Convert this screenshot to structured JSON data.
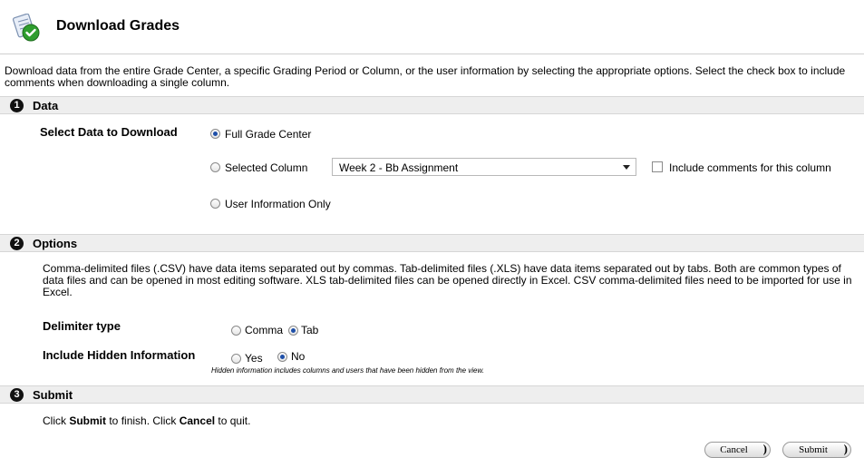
{
  "header": {
    "title": "Download Grades",
    "icon": "download-grades-icon"
  },
  "intro": "Download data from the entire Grade Center, a specific Grading Period or Column, or the user information by selecting the appropriate options. Select the check box to include comments when downloading a single column.",
  "steps": [
    {
      "number": "1",
      "title": "Data"
    },
    {
      "number": "2",
      "title": "Options"
    },
    {
      "number": "3",
      "title": "Submit"
    }
  ],
  "data_section": {
    "label": "Select Data to Download",
    "options": [
      {
        "label": "Full Grade Center",
        "checked": true
      },
      {
        "label": "Selected Column",
        "checked": false
      },
      {
        "label": "User Information Only",
        "checked": false
      }
    ],
    "column_select": {
      "value": "Week 2 - Bb Assignment"
    },
    "include_comments": {
      "label": "Include comments for this column",
      "checked": false
    }
  },
  "options_section": {
    "description": "Comma-delimited files (.CSV) have data items separated out by commas. Tab-delimited files (.XLS) have data items separated out by tabs. Both are common types of data files and can be opened in most editing software. XLS tab-delimited files can be opened directly in Excel. CSV comma-delimited files need to be imported for use in Excel.",
    "delimiter": {
      "label": "Delimiter type",
      "options": [
        {
          "label": "Comma",
          "checked": false
        },
        {
          "label": "Tab",
          "checked": true
        }
      ]
    },
    "hidden": {
      "label": "Include Hidden Information",
      "options": [
        {
          "label": "Yes",
          "checked": false
        },
        {
          "label": "No",
          "checked": true
        }
      ],
      "hint": "Hidden information includes columns and users that have been hidden from the view."
    }
  },
  "submit_section": {
    "prefix": "Click ",
    "submit_word": "Submit",
    "middle": " to finish. Click ",
    "cancel_word": "Cancel",
    "suffix": " to quit."
  },
  "buttons": {
    "cancel": "Cancel",
    "submit": "Submit"
  },
  "colors": {
    "step_bar": "#eeeeee",
    "radio_dot": "#1e4fa8",
    "icon_green": "#2f9e2f"
  }
}
